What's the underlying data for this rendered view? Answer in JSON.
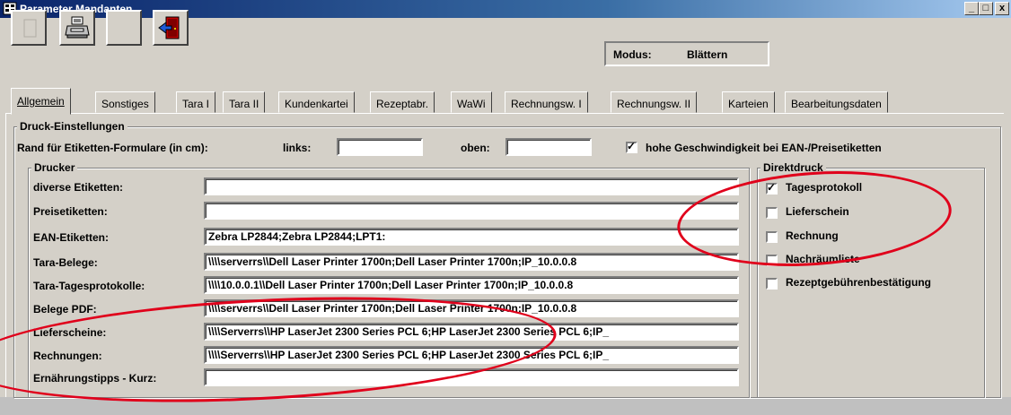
{
  "window": {
    "title": "Parameter Mandanten"
  },
  "toolbar": {
    "buttons": [
      {
        "name": "new-icon"
      },
      {
        "name": "printer-icon"
      },
      {
        "name": "blank-icon"
      },
      {
        "name": "exit-door-icon"
      }
    ],
    "modus_label": "Modus:",
    "modus_value": "Blättern"
  },
  "tabs": [
    {
      "label": "Allgemein",
      "active": true
    },
    {
      "label": "Sonstiges"
    },
    {
      "label": "Tara I"
    },
    {
      "label": "Tara II"
    },
    {
      "label": "Kundenkartei"
    },
    {
      "label": "Rezeptabr."
    },
    {
      "label": "WaWi"
    },
    {
      "label": "Rechnungsw. I"
    },
    {
      "label": "Rechnungsw. II"
    },
    {
      "label": "Karteien"
    },
    {
      "label": "Bearbeitungsdaten"
    }
  ],
  "druck": {
    "title": "Druck-Einstellungen",
    "rand_label": "Rand für Etiketten-Formulare (in cm):",
    "links_label": "links:",
    "links_value": "",
    "oben_label": "oben:",
    "oben_value": "",
    "speed_label": "hohe Geschwindigkeit bei EAN-/Preisetiketten",
    "speed_checked": true
  },
  "drucker": {
    "title": "Drucker",
    "rows": [
      {
        "label": "diverse Etiketten:",
        "value": ""
      },
      {
        "label": "Preisetiketten:",
        "value": ""
      },
      {
        "label": "EAN-Etiketten:",
        "value": "Zebra  LP2844;Zebra  LP2844;LPT1:"
      },
      {
        "label": "Tara-Belege:",
        "value": "\\\\\\\\serverrs\\\\Dell Laser Printer 1700n;Dell Laser Printer 1700n;IP_10.0.0.8"
      },
      {
        "label": "Tara-Tagesprotokolle:",
        "value": "\\\\\\\\10.0.0.1\\\\Dell Laser Printer 1700n;Dell Laser Printer 1700n;IP_10.0.0.8"
      },
      {
        "label": "Belege PDF:",
        "value": "\\\\\\\\serverrs\\\\Dell Laser Printer 1700n;Dell Laser Printer 1700n;IP_10.0.0.8"
      },
      {
        "label": "Lieferscheine:",
        "value": "\\\\\\\\Serverrs\\\\HP LaserJet 2300 Series PCL 6;HP LaserJet 2300 Series PCL 6;IP_"
      },
      {
        "label": "Rechnungen:",
        "value": "\\\\\\\\Serverrs\\\\HP LaserJet 2300 Series PCL 6;HP LaserJet 2300 Series PCL 6;IP_"
      },
      {
        "label": "Ernährungstipps - Kurz:",
        "value": ""
      }
    ]
  },
  "direktdruck": {
    "title": "Direktdruck",
    "items": [
      {
        "label": "Tagesprotokoll",
        "checked": true
      },
      {
        "label": "Lieferschein",
        "checked": false
      },
      {
        "label": "Rechnung",
        "checked": false
      },
      {
        "label": "Nachräumliste",
        "checked": false
      },
      {
        "label": "Rezeptgebührenbestätigung",
        "checked": false
      }
    ]
  },
  "colors": {
    "annotation": "#e0001b",
    "titlebar": "#0a246a",
    "face": "#d4d0c8"
  }
}
